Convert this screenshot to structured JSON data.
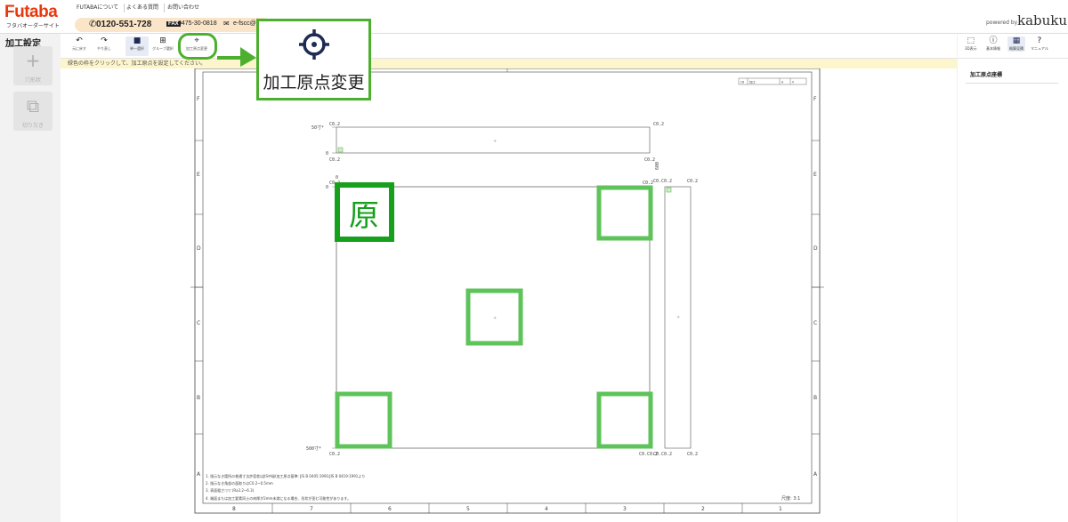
{
  "header": {
    "logo": "Futaba",
    "logo_sub": "フタバオーダーサイト",
    "nav": [
      "FUTABAについて",
      "よくある質問",
      "お問い合わせ"
    ],
    "tel": "0120-551-728",
    "fax_label": "FAX",
    "fax": "0475-30-0818",
    "mail": "e-fscc@",
    "powered": "powered by",
    "brand": "kabuku"
  },
  "left_panel": {
    "title": "加工設定",
    "buttons": [
      {
        "icon": "plus-icon",
        "label": "穴形状"
      },
      {
        "icon": "cut-icon",
        "label": "切り欠き"
      }
    ]
  },
  "toolbar": {
    "buttons": [
      {
        "icon": "undo-icon",
        "label": "元に戻す",
        "glyph": "↶"
      },
      {
        "icon": "redo-icon",
        "label": "やり直し",
        "glyph": "↷"
      },
      {
        "icon": "single-select-icon",
        "label": "単一選択",
        "glyph": "■"
      },
      {
        "icon": "group-select-icon",
        "label": "グループ選択",
        "glyph": "⊞"
      },
      {
        "icon": "origin-target-icon",
        "label": "加工原点変更",
        "glyph": "⌖"
      }
    ],
    "hint": "緑色の枠をクリックして、加工原点を設定してください。"
  },
  "right_toolbar": {
    "buttons": [
      {
        "icon": "3d-view-icon",
        "label": "3D表示",
        "glyph": "⬚"
      },
      {
        "icon": "info-icon",
        "label": "基本情報",
        "glyph": "ⓘ"
      },
      {
        "icon": "calculator-icon",
        "label": "概算見積",
        "glyph": "▦"
      },
      {
        "icon": "help-icon",
        "label": "マニュアル",
        "glyph": "?"
      }
    ]
  },
  "right_panel": {
    "title": "加工原点座標"
  },
  "callout": {
    "label": "加工原点変更"
  },
  "origin_marker": "原",
  "drawing": {
    "row_labels": [
      "F",
      "E",
      "D",
      "C",
      "B",
      "A"
    ],
    "col_labels": [
      "8",
      "7",
      "6",
      "5",
      "4",
      "3",
      "2",
      "1"
    ],
    "chamfer": "C0.2",
    "chamfer_pair": "C0.C0.2",
    "dim_50": "50寸*",
    "dim_500": "500寸*",
    "dim_zero": "0",
    "dim_600": "600",
    "scale": "尺度: 3:1",
    "title_block": [
      "CD",
      "加工",
      "A",
      "V"
    ],
    "notes": [
      "1. 指示なき箇所の普通寸法許容差はJIS中級(加工原点基準: JIS B 0405:1991/JIS B 0419:1991より",
      "2. 指示なき角部の面取りはC0.2~0.5mm",
      "3. 表面粗さ:▽▽ (Ra3.2~6.3)",
      "4. 端面または加工要素同士の肉厚が2mm未満になる場合、形状が歪む可能性があります。"
    ]
  },
  "colors": {
    "accent_green": "#4caf2e",
    "marker_green": "#5dc35a",
    "logo_red": "#e8380d",
    "hint_bg": "#fdf6cc",
    "icon_navy": "#1f2a55"
  }
}
